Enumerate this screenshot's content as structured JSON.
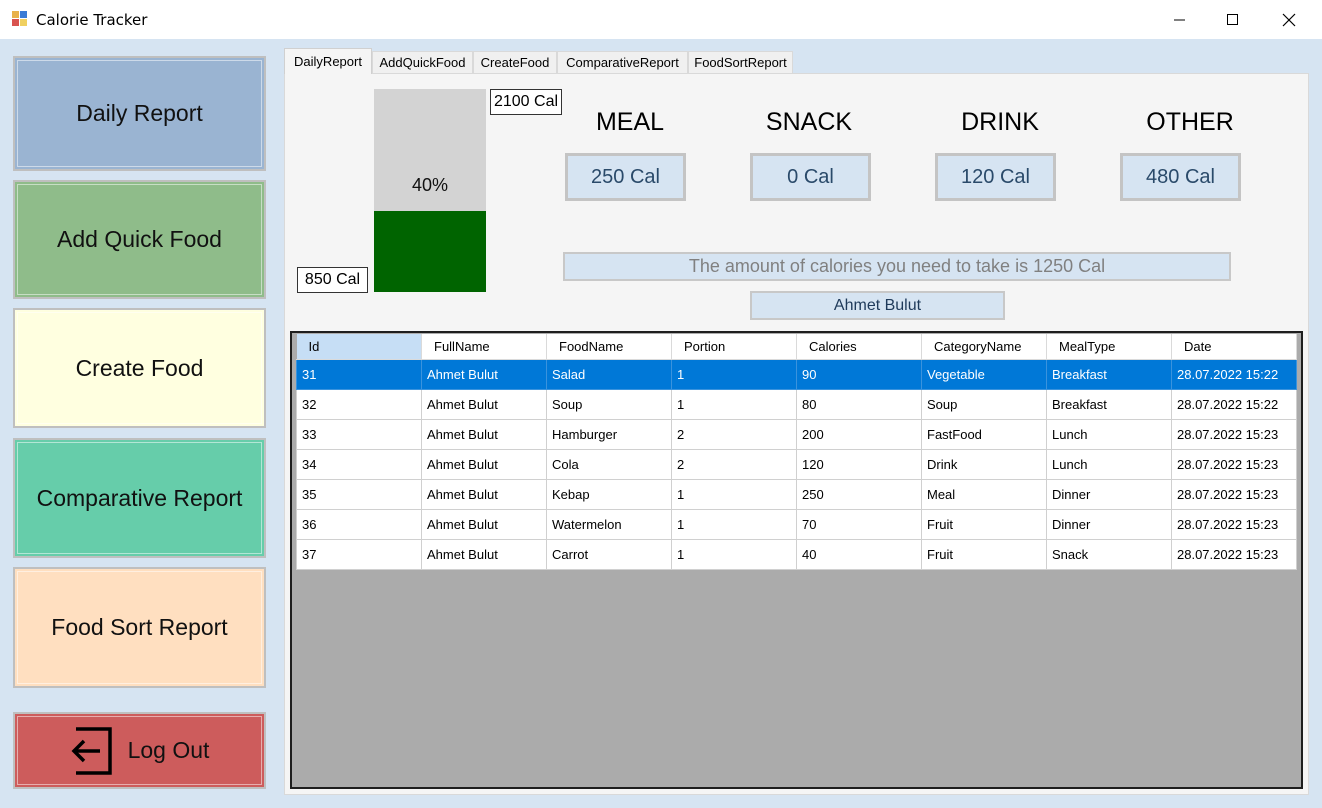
{
  "window": {
    "title": "Calorie Tracker",
    "minimize_icon": "minimize-icon",
    "maximize_icon": "maximize-icon",
    "close_icon": "close-icon"
  },
  "nav": {
    "daily_report": "Daily Report",
    "add_quick_food": "Add Quick Food",
    "create_food": "Create Food",
    "comparative_report": "Comparative Report",
    "food_sort_report": "Food Sort Report",
    "log_out": "Log Out",
    "log_out_icon": "logout-icon",
    "colors": {
      "daily_report": "#9ab4d2",
      "add_quick_food": "#8fbc8a",
      "create_food": "#ffffe0",
      "comparative_report": "#66cdaa",
      "food_sort_report": "#ffdfc0",
      "log_out": "#cd5c5c"
    }
  },
  "tabs": [
    "DailyReport",
    "AddQuickFood",
    "CreateFood",
    "ComparativeReport",
    "FoodSortReport"
  ],
  "daily": {
    "target_label": "2100 Cal",
    "consumed_label": "850 Cal",
    "progress_text": "40%",
    "progress_fraction": 0.4,
    "progress_color": "#006400",
    "categories": [
      {
        "title": "MEAL",
        "value": "250 Cal"
      },
      {
        "title": "SNACK",
        "value": "0 Cal"
      },
      {
        "title": "DRINK",
        "value": "120 Cal"
      },
      {
        "title": "OTHER",
        "value": "480 Cal"
      }
    ],
    "remaining_text": "The amount of calories you need to take is 1250 Cal",
    "user_name": "Ahmet Bulut"
  },
  "grid": {
    "columns": [
      "Id",
      "FullName",
      "FoodName",
      "Portion",
      "Calories",
      "CategoryName",
      "MealType",
      "Date"
    ],
    "selected_color": "#0078d7",
    "rows": [
      [
        "31",
        "Ahmet Bulut",
        "Salad",
        "1",
        "90",
        "Vegetable",
        "Breakfast",
        "28.07.2022 15:22"
      ],
      [
        "32",
        "Ahmet Bulut",
        "Soup",
        "1",
        "80",
        "Soup",
        "Breakfast",
        "28.07.2022 15:22"
      ],
      [
        "33",
        "Ahmet Bulut",
        "Hamburger",
        "2",
        "200",
        "FastFood",
        "Lunch",
        "28.07.2022 15:23"
      ],
      [
        "34",
        "Ahmet Bulut",
        "Cola",
        "2",
        "120",
        "Drink",
        "Lunch",
        "28.07.2022 15:23"
      ],
      [
        "35",
        "Ahmet Bulut",
        "Kebap",
        "1",
        "250",
        "Meal",
        "Dinner",
        "28.07.2022 15:23"
      ],
      [
        "36",
        "Ahmet Bulut",
        "Watermelon",
        "1",
        "70",
        "Fruit",
        "Dinner",
        "28.07.2022 15:23"
      ],
      [
        "37",
        "Ahmet Bulut",
        "Carrot",
        "1",
        "40",
        "Fruit",
        "Snack",
        "28.07.2022 15:23"
      ]
    ]
  }
}
